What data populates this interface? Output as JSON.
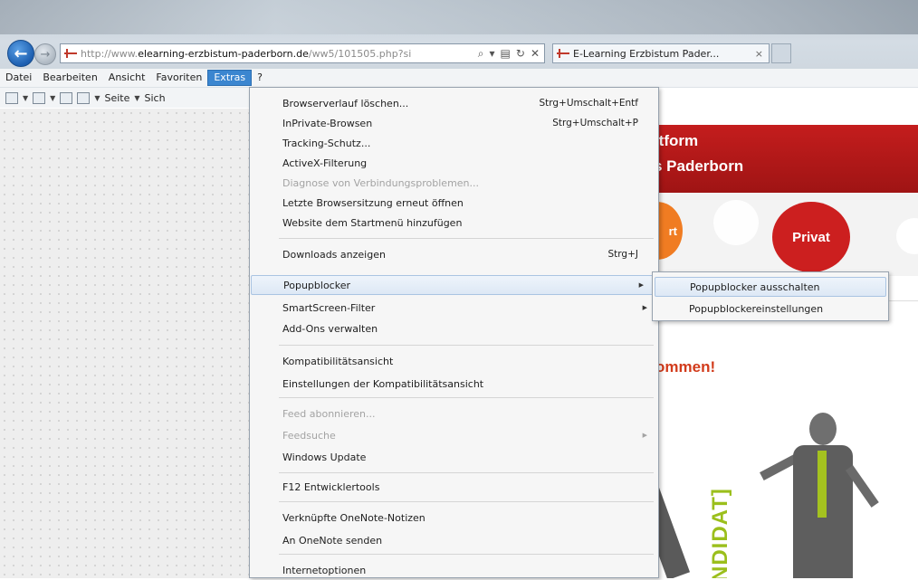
{
  "browser": {
    "url_prefix": "http://www.",
    "url_domain": "elearning-erzbistum-paderborn.de",
    "url_path": "/ww5/101505.php?si",
    "tab_title": "E-Learning Erzbistum Pader...",
    "tab_close": "×",
    "addr_icons": [
      "⌕",
      "▾",
      "▤",
      "↻",
      "✕"
    ]
  },
  "menubar": [
    "Datei",
    "Bearbeiten",
    "Ansicht",
    "Favoriten",
    "Extras",
    "?"
  ],
  "cmdbar": {
    "page_label": "Seite",
    "safety_label": "Sich"
  },
  "extras_menu": [
    {
      "label": "Browserverlauf löschen...",
      "shortcut": "Strg+Umschalt+Entf"
    },
    {
      "label": "InPrivate-Browsen",
      "shortcut": "Strg+Umschalt+P"
    },
    {
      "label": "Tracking-Schutz...",
      "shortcut": ""
    },
    {
      "label": "ActiveX-Filterung",
      "shortcut": ""
    },
    {
      "label": "Diagnose von Verbindungsproblemen...",
      "shortcut": "",
      "disabled": true
    },
    {
      "label": "Letzte Browsersitzung erneut öffnen",
      "shortcut": ""
    },
    {
      "label": "Website dem Startmenü hinzufügen",
      "shortcut": ""
    },
    {
      "label": "Downloads anzeigen",
      "shortcut": "Strg+J"
    },
    {
      "label": "Popupblocker",
      "shortcut": "",
      "submenu": true
    },
    {
      "label": "SmartScreen-Filter",
      "shortcut": "",
      "submenu": true
    },
    {
      "label": "Add-Ons verwalten",
      "shortcut": ""
    },
    {
      "label": "Kompatibilitätsansicht",
      "shortcut": ""
    },
    {
      "label": "Einstellungen der Kompatibilitätsansicht",
      "shortcut": ""
    },
    {
      "label": "Feed abonnieren...",
      "shortcut": "",
      "disabled": true
    },
    {
      "label": "Feedsuche",
      "shortcut": "",
      "disabled": true,
      "submenu": true
    },
    {
      "label": "Windows Update",
      "shortcut": ""
    },
    {
      "label": "F12 Entwicklertools",
      "shortcut": ""
    },
    {
      "label": "Verknüpfte OneNote-Notizen",
      "shortcut": ""
    },
    {
      "label": "An OneNote senden",
      "shortcut": ""
    },
    {
      "label": "Internetoptionen",
      "shortcut": ""
    }
  ],
  "popup_submenu": [
    "Popupblocker ausschalten",
    "Popupblockereinstellungen"
  ],
  "page": {
    "banner_line1": "ttform",
    "banner_line2": "s Paderborn",
    "orange_label": "rt",
    "red_label": "Privat",
    "welcome": "ommen!",
    "kandidat": "NDIDAT]"
  }
}
